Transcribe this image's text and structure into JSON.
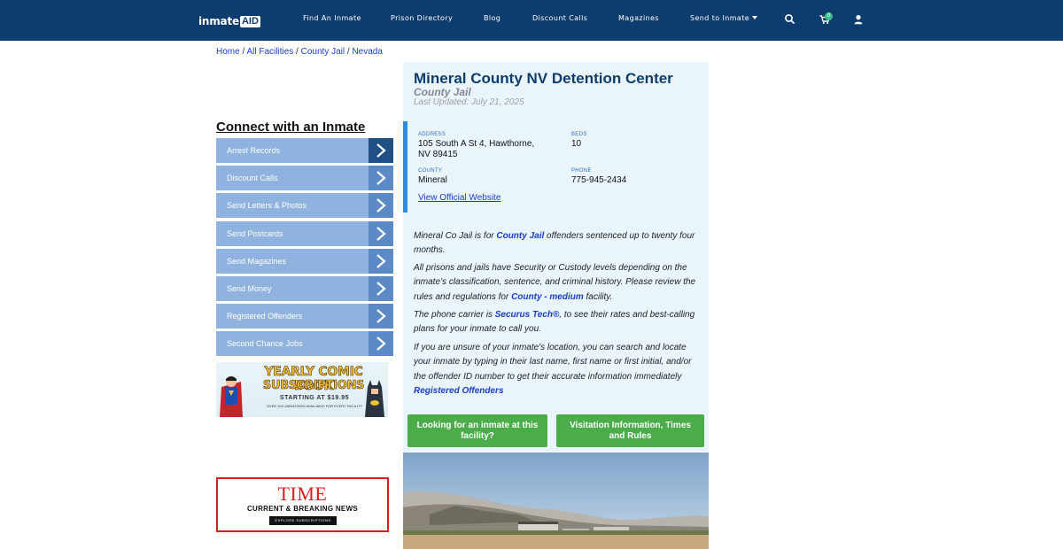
{
  "header": {
    "logo_main": "inmate",
    "logo_badge": "AID",
    "nav": [
      {
        "label": "Find An Inmate"
      },
      {
        "label": "Prison Directory"
      },
      {
        "label": "Blog"
      },
      {
        "label": "Discount Calls"
      },
      {
        "label": "Magazines"
      },
      {
        "label": "Send to Inmate"
      }
    ],
    "cart_count": "0",
    "icons": [
      "search-icon",
      "cart-icon",
      "user-icon",
      "chevron-down-icon"
    ]
  },
  "breadcrumb": {
    "items": [
      "Home",
      "All Facilities",
      "County Jail",
      "Nevada"
    ],
    "separator": " / "
  },
  "sidebar": {
    "title": "Connect with an Inmate",
    "items": [
      {
        "label": "Arrest Records"
      },
      {
        "label": "Discount Calls"
      },
      {
        "label": "Send Letters & Photos"
      },
      {
        "label": "Send Postcards"
      },
      {
        "label": "Send Magazines"
      },
      {
        "label": "Send Money"
      },
      {
        "label": "Registered Offenders"
      },
      {
        "label": "Second Chance Jobs"
      }
    ]
  },
  "ads": {
    "comic": {
      "line1": "YEARLY COMIC BOOK",
      "line2": "SUBSCRIPTIONS",
      "line3": "STARTING AT $19.95",
      "line4": "OVER 100 VARIATIONS AVAILABLE FOR EVERY FACILITY"
    },
    "time": {
      "logo": "TIME",
      "subtitle": "CURRENT & BREAKING NEWS",
      "button": "EXPLORE SUBSCRIPTIONS"
    }
  },
  "facility": {
    "name": "Mineral County NV Detention Center",
    "type": "County Jail",
    "updated": "Last Updated: July 21, 2025",
    "address_label": "ADDRESS",
    "address_line1": "105 South A St 4, Hawthorne,",
    "address_line2": "NV 89415",
    "beds_label": "BEDS",
    "beds": "10",
    "county_label": "COUNTY",
    "county": "Mineral",
    "phone_label": "PHONE",
    "phone": "775-945-2434",
    "website": "View Official Website"
  },
  "description": {
    "p1_pre": "Mineral Co Jail is for ",
    "p1_link": "County Jail",
    "p1_post": " offenders sentenced up to twenty four months.",
    "p2_pre": "All prisons and jails have Security or Custody levels depending on the inmate’s classification, sentence, and criminal history. Please review the rules and regulations for ",
    "p2_link": "County - medium",
    "p2_post": " facility.",
    "p3_pre": "The phone carrier is ",
    "p3_link": "Securus Tech®",
    "p3_post": ", to see their rates and best-calling plans for your inmate to call you.",
    "p4_pre": "If you are unsure of your inmate's location, you can search and locate your inmate by typing in their last name, first name or first initial, and/or the offender ID number to get their accurate information immediately ",
    "p4_link": "Registered Offenders"
  },
  "buttons": {
    "find_inmate": "Looking for an inmate at this facility?",
    "visitation": "Visitation Information, Times and Rules"
  }
}
